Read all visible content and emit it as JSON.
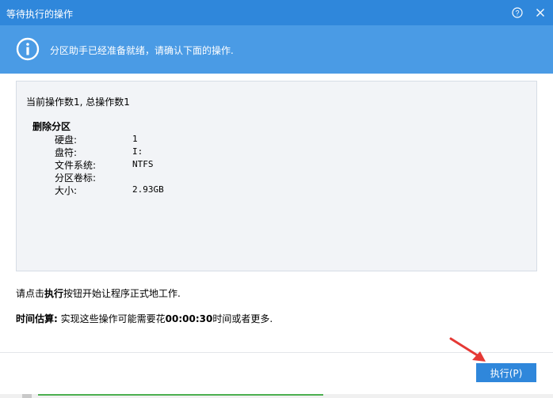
{
  "window": {
    "title": "等待执行的操作"
  },
  "banner": {
    "message": "分区助手已经准备就绪，请确认下面的操作."
  },
  "operations": {
    "summary": "当前操作数1, 总操作数1",
    "title": "删除分区",
    "fields": [
      {
        "label": "硬盘:",
        "value": "1"
      },
      {
        "label": "盘符:",
        "value": "I:"
      },
      {
        "label": "文件系统:",
        "value": "NTFS"
      },
      {
        "label": "分区卷标:",
        "value": ""
      },
      {
        "label": "大小:",
        "value": "2.93GB"
      }
    ]
  },
  "hint": {
    "prefix": "请点击",
    "bold": "执行",
    "suffix": "按钮开始让程序正式地工作."
  },
  "estimate": {
    "label": "时间估算:",
    "text_before": " 实现这些操作可能需要花",
    "time": "00:00:30",
    "text_after": "时间或者更多."
  },
  "buttons": {
    "execute": "执行(P)"
  },
  "colors": {
    "titlebar": "#2f87db",
    "banner": "#4a9be5",
    "arrow": "#e53935"
  },
  "icons": {
    "help": "question-circle-icon",
    "close": "close-icon",
    "info": "info-circle-icon",
    "arrow": "red-arrow-icon"
  }
}
